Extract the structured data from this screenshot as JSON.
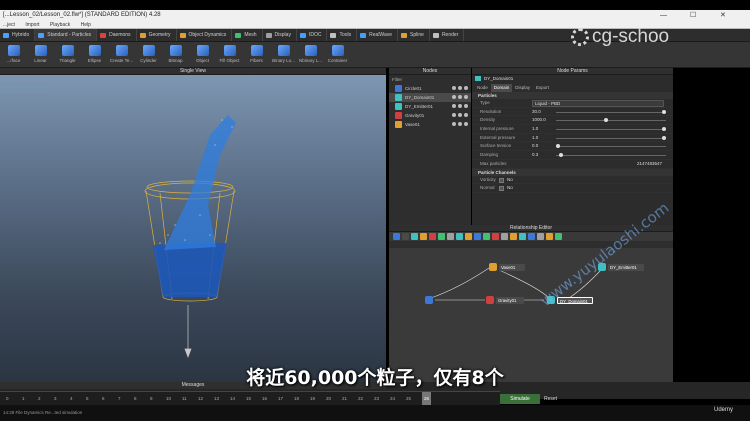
{
  "window": {
    "title": "[...Lesson_02/Lesson_02.flw*] (STANDARD EDITION) 4.28",
    "controls": [
      "—",
      "☐",
      "✕"
    ]
  },
  "menu": [
    "...ject",
    "Import",
    "Playback",
    "Help"
  ],
  "shelf_tabs": [
    {
      "label": "Hybrido",
      "color": "#4aa0ff"
    },
    {
      "label": "Standard - Particles",
      "color": "#4aa0ff"
    },
    {
      "label": "Daemons",
      "color": "#e04040"
    },
    {
      "label": "Geometry",
      "color": "#e0a030"
    },
    {
      "label": "Object Dynamics",
      "color": "#e0a030"
    },
    {
      "label": "Mesh",
      "color": "#40c070"
    },
    {
      "label": "Display",
      "color": "#a0a0a0"
    },
    {
      "label": "IDOC",
      "color": "#40a0ff"
    },
    {
      "label": "Tools",
      "color": "#c0c0c0"
    },
    {
      "label": "RealWave",
      "color": "#40a0ff"
    },
    {
      "label": "Spline",
      "color": "#e0a030"
    },
    {
      "label": "Render",
      "color": "#c0c0c0"
    }
  ],
  "tools": [
    "...rface",
    "Linear",
    "Triangle",
    "Ellipse",
    "Create Te...",
    "Cylinder",
    "Bitmap",
    "Object",
    "Fill Object",
    "Fibers",
    "Binary Lo...",
    "Nbinary L...",
    "Container"
  ],
  "viewport": {
    "title": "Single View"
  },
  "nodes": {
    "title": "Nodes",
    "filter_label": "Filter",
    "items": [
      {
        "label": "Circle01",
        "color": "#3c78d8"
      },
      {
        "label": "DY_Domain01",
        "color": "#40c0c0",
        "selected": true
      },
      {
        "label": "DY_Emitter01",
        "color": "#40c0c0"
      },
      {
        "label": "Gravity01",
        "color": "#d04040"
      },
      {
        "label": "Vase01",
        "color": "#e0a030"
      }
    ]
  },
  "params": {
    "title": "Node Params",
    "node_name": "DY_Domain01",
    "tabs": [
      "Node",
      "Domain",
      "Display",
      "Export"
    ],
    "active_tab": "Domain",
    "group_particles": "Particles",
    "rows": [
      {
        "label": "Type",
        "value": "Liquid - PBD"
      },
      {
        "label": "Resolution",
        "value": "30.0",
        "level": 1.0
      },
      {
        "label": "Density",
        "value": "1000.0",
        "level": 0.45
      },
      {
        "label": "Internal pressure",
        "value": "1.0",
        "level": 1.0
      },
      {
        "label": "External pressure",
        "value": "1.0",
        "level": 1.0
      },
      {
        "label": "Surface tension",
        "value": "0.0",
        "level": 0.0
      },
      {
        "label": "Damping",
        "value": "0.3",
        "level": 0.03
      },
      {
        "label": "Max particles",
        "value": "2147483647"
      }
    ],
    "group_channels": "Particle Channels",
    "channels": [
      {
        "label": "Vorticity",
        "value": "No"
      },
      {
        "label": "Normal",
        "value": "No"
      }
    ]
  },
  "relationship_editor": {
    "title": "Relationship Editor",
    "nodes": [
      "Vase01",
      "DY_Emitter01",
      "Gravity01",
      "DY_Domain01"
    ]
  },
  "messages": {
    "title": "Messages"
  },
  "timeline": {
    "frames": [
      "0",
      "1",
      "2",
      "3",
      "4",
      "5",
      "6",
      "7",
      "8",
      "9",
      "10",
      "11",
      "12",
      "13",
      "14",
      "15",
      "16",
      "17",
      "18",
      "19",
      "20",
      "21",
      "22",
      "23",
      "24",
      "25",
      "26"
    ],
    "current_frame": "26",
    "buttons": {
      "simulate": "Simulate",
      "reset": "Reset"
    }
  },
  "status": "14:28 File Dynamics Re...ted simulation",
  "logo": {
    "text": "cg-schoo"
  },
  "subtitle": {
    "prefix": "将近",
    "number": "60,000",
    "middle": "个粒子，仅有",
    "count": "8",
    "suffix": "个"
  },
  "watermark": "www.yuyulaoshi.com",
  "udemy": "Udemy"
}
